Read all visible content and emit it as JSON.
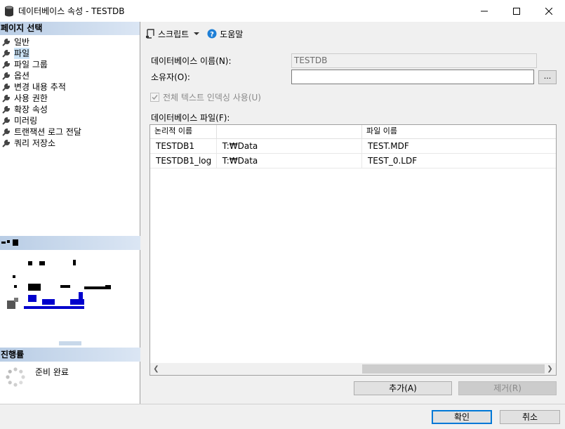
{
  "window": {
    "title": "데이터베이스 속성 - TESTDB"
  },
  "left_pane": {
    "select_page_header": "페이지 선택",
    "pages": [
      {
        "label": "일반",
        "selected": false
      },
      {
        "label": "파일",
        "selected": true
      },
      {
        "label": "파일 그룹",
        "selected": false
      },
      {
        "label": "옵션",
        "selected": false
      },
      {
        "label": "변경 내용 추적",
        "selected": false
      },
      {
        "label": "사용 권한",
        "selected": false
      },
      {
        "label": "확장 속성",
        "selected": false
      },
      {
        "label": "미러링",
        "selected": false
      },
      {
        "label": "트랜잭션 로그 전달",
        "selected": false
      },
      {
        "label": "쿼리 저장소",
        "selected": false
      }
    ],
    "progress_header": "진행률",
    "progress_status": "준비 완료"
  },
  "toolbar": {
    "script_label": "스크립트",
    "help_label": "도움말"
  },
  "form": {
    "db_name_label": "데이터베이스 이름(N):",
    "db_name_value": "TESTDB",
    "owner_label": "소유자(O):",
    "owner_value": "",
    "browse_label": "...",
    "fulltext_label": "전체 텍스트 인덱싱 사용(U)",
    "fulltext_checked": true,
    "db_files_label": "데이터베이스 파일(F):"
  },
  "grid": {
    "headers": [
      "논리적 이름",
      "",
      "파일 이름"
    ],
    "rows": [
      [
        "TESTDB1",
        "T:₩Data",
        "TEST.MDF"
      ],
      [
        "TESTDB1_log",
        "T:₩Data",
        "TEST_0.LDF"
      ]
    ]
  },
  "buttons": {
    "add": "추가(A)",
    "remove": "제거(R)",
    "ok": "확인",
    "cancel": "취소"
  }
}
